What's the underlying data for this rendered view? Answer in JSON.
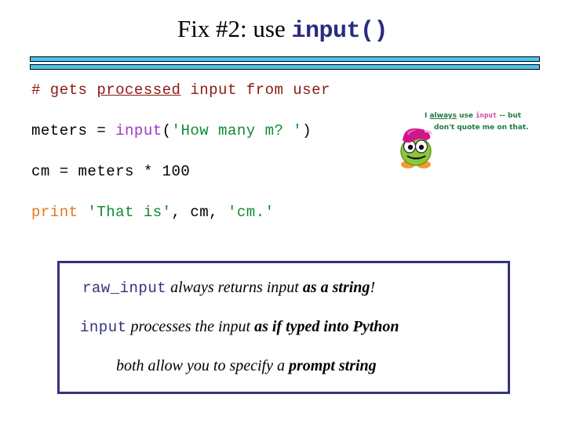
{
  "title": {
    "text_plain": "Fix #2: use ",
    "text_mono": "input()"
  },
  "code": {
    "line1": {
      "hash": "# gets ",
      "underlined": "processed",
      "tail": " input from user"
    },
    "line2": {
      "assign": "meters = ",
      "func": "input",
      "open_paren": "(",
      "string": "'How many m? '",
      "close_paren": ")"
    },
    "line3": {
      "text": "cm = meters * 100"
    },
    "line4": {
      "kw": "print",
      "space": " ",
      "string1": "'That is'",
      "comma1": ", ",
      "var": "cm",
      "comma2": ", ",
      "string2": "'cm.'"
    }
  },
  "annotation": {
    "line1_a": "I ",
    "line1_underlined": "always",
    "line1_b": " use ",
    "line1_code": "input",
    "line1_c": " -- but",
    "line2": "don't quote me on that."
  },
  "mascot": {
    "alt": "green-creature-with-pink-hat"
  },
  "summary": {
    "line1": {
      "mono": "raw_input",
      "italic_a": "  always returns input ",
      "bold_italic": "as a string",
      "italic_b": "!"
    },
    "line2": {
      "mono": "input",
      "italic_a": "  processes the input ",
      "bold_italic": "as if typed into Python"
    },
    "line3": {
      "italic_a": "both allow you to specify a ",
      "bold_italic": "prompt string"
    }
  },
  "colors": {
    "title_accent": "#2b2b7f",
    "rule_fill": "#4ec3f0",
    "comment": "#8b1a12",
    "function": "#9d38c9",
    "string": "#0f8a34",
    "keyword": "#e07a18",
    "box_border": "#33337a",
    "annotation": "#1f7a3d",
    "annotation_code": "#d0489e"
  }
}
